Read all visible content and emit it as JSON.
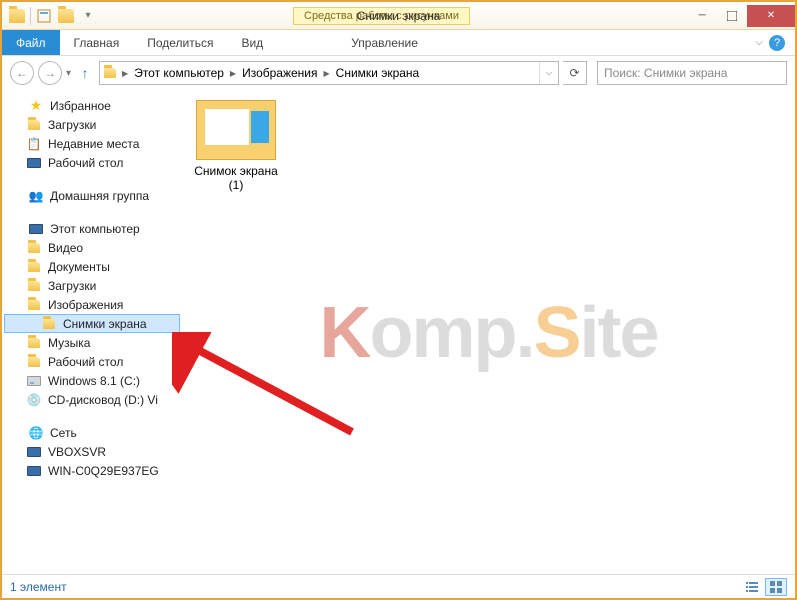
{
  "titlebar": {
    "context_tab": "Средства работы с рисунками",
    "title": "Снимки экрана"
  },
  "ribbon": {
    "file": "Файл",
    "tabs": [
      "Главная",
      "Поделиться",
      "Вид"
    ],
    "context": "Управление"
  },
  "breadcrumb": [
    "Этот компьютер",
    "Изображения",
    "Снимки экрана"
  ],
  "search_placeholder": "Поиск: Снимки экрана",
  "nav": {
    "favorites": {
      "label": "Избранное",
      "items": [
        "Загрузки",
        "Недавние места",
        "Рабочий стол"
      ]
    },
    "homegroup": "Домашняя группа",
    "computer": {
      "label": "Этот компьютер",
      "items": [
        "Видео",
        "Документы",
        "Загрузки",
        "Изображения",
        "Снимки экрана",
        "Музыка",
        "Рабочий стол",
        "Windows 8.1 (C:)",
        "CD-дисковод (D:) Vi"
      ]
    },
    "network": {
      "label": "Сеть",
      "items": [
        "VBOXSVR",
        "WIN-C0Q29E937EG"
      ]
    }
  },
  "files": [
    {
      "name_l1": "Снимок экрана",
      "name_l2": "(1)"
    }
  ],
  "statusbar": {
    "count": "1 элемент"
  },
  "watermark": {
    "k": "K",
    "omp": "omp.",
    "s": "S",
    "ite": "ite"
  }
}
